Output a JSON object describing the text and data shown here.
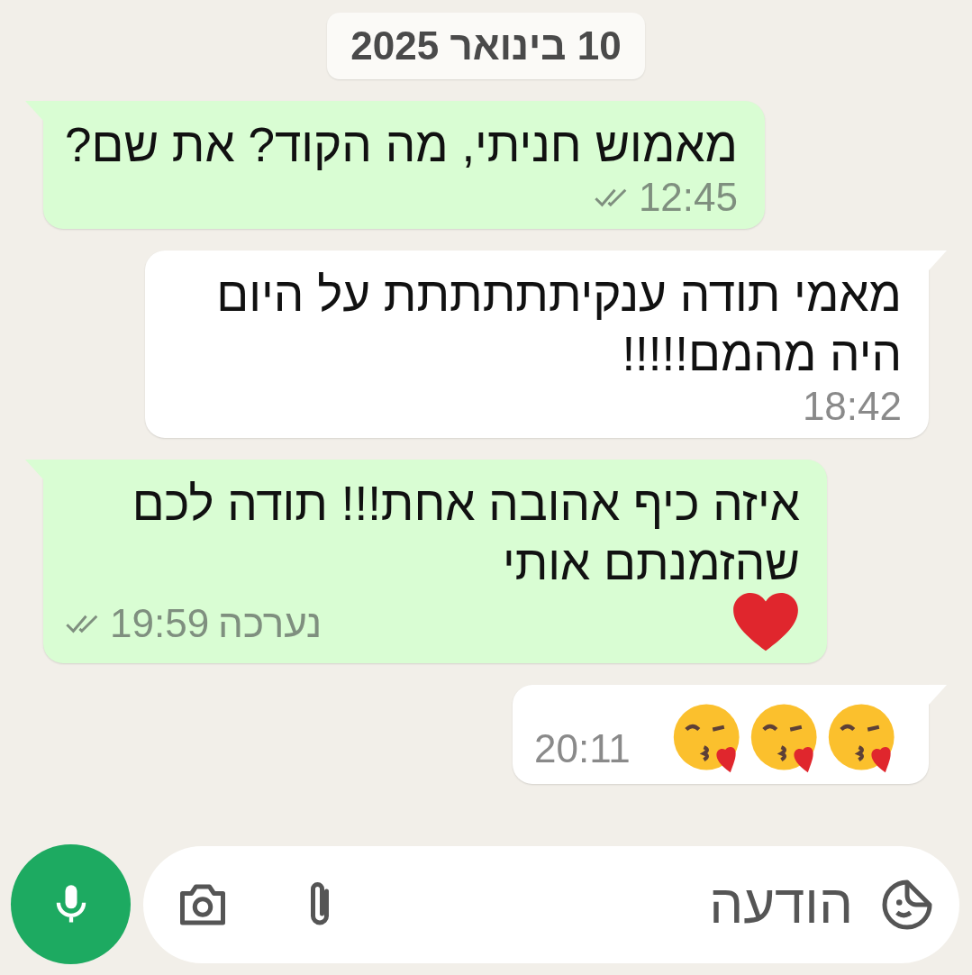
{
  "date_chip": "10 בינואר 2025",
  "messages": [
    {
      "kind": "sent",
      "text": "מאמוש חניתי, מה הקוד? את שם?",
      "time": "12:45",
      "delivered": true
    },
    {
      "kind": "received",
      "text": "מאמי תודה ענקיתתתתתת על היום היה מהמם!!!!!",
      "time": "18:42"
    },
    {
      "kind": "sent",
      "text": "איזה כיף אהובה אחת!!!  תודה לכם שהזמנתם אותי",
      "trailing_emoji": {
        "kind": "heart"
      },
      "edited_label": "נערכה",
      "time": "19:59",
      "delivered": true
    },
    {
      "kind": "received",
      "emojis": [
        {
          "kind": "kiss"
        },
        {
          "kind": "kiss"
        },
        {
          "kind": "kiss"
        }
      ],
      "time": "20:11"
    }
  ],
  "composer": {
    "placeholder": "הודעה"
  }
}
